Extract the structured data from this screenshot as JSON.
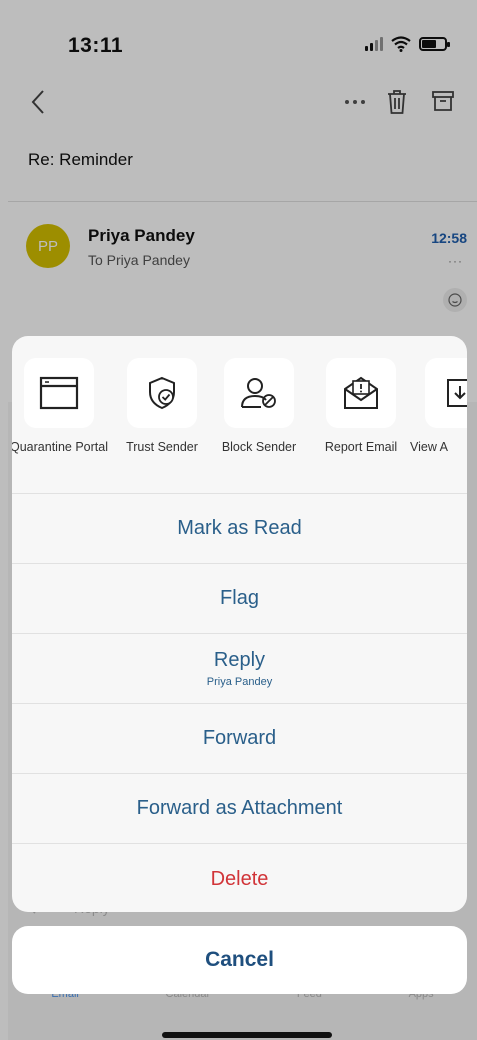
{
  "status_bar": {
    "time": "13:11"
  },
  "email": {
    "subject": "Re: Reminder",
    "avatar_initials": "PP",
    "avatar_color": "#d4c000",
    "sender": "Priya Pandey",
    "recipient": "To Priya Pandey",
    "time": "12:58",
    "more": "···"
  },
  "tools": [
    {
      "label": "Quarantine Portal",
      "icon": "window-icon"
    },
    {
      "label": "Trust Sender",
      "icon": "shield-check-icon"
    },
    {
      "label": "Block Sender",
      "icon": "person-block-icon"
    },
    {
      "label": "Report Email",
      "icon": "report-envelope-icon"
    },
    {
      "label": "View A",
      "icon": "download-icon"
    }
  ],
  "actions": {
    "mark_as_read": "Mark as Read",
    "flag": "Flag",
    "reply": "Reply",
    "reply_sub": "Priya Pandey",
    "forward": "Forward",
    "forward_attachment": "Forward as Attachment",
    "delete": "Delete"
  },
  "cancel": "Cancel",
  "reply_bar": {
    "label": "Reply"
  },
  "tabs": [
    "Email",
    "Calendar",
    "Feed",
    "Apps"
  ],
  "colors": {
    "accent": "#2a5f8a",
    "danger": "#d13438",
    "time_blue": "#1f5fae"
  }
}
